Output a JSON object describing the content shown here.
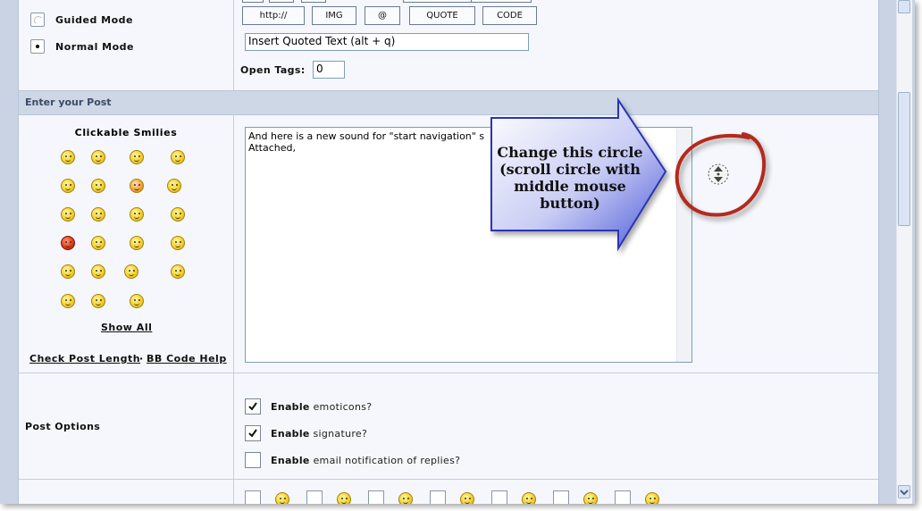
{
  "editor_mode": {
    "guided_label": "Guided Mode",
    "normal_label": "Normal Mode"
  },
  "toolbar": {
    "http_label": "http://",
    "img_label": "IMG",
    "mention_label": "@",
    "quote_label": "QUOTE",
    "code_label": "CODE",
    "quoted_text_value": "Insert Quoted Text (alt + q)",
    "open_tags_label": "Open Tags:",
    "open_tags_value": "0"
  },
  "section": {
    "enter_post_title": "Enter your Post"
  },
  "smilies": {
    "title": "Clickable Smilies",
    "show_all": "Show All",
    "check_length": "Check Post Length",
    "separator": "·",
    "bbcode_help": "BB Code Help"
  },
  "post": {
    "body_line1": "And here is a new sound for \"start navigation\" s",
    "body_line2": "Attached,"
  },
  "post_options": {
    "title": "Post Options",
    "enable_word": "Enable",
    "emoticons_rest": "emoticons?",
    "signature_rest": "signature?",
    "notify_rest": "email notification of replies?",
    "emoticons_checked": true,
    "signature_checked": true,
    "notify_checked": false
  },
  "annotation": {
    "text": "Change this circle (scroll circle with middle mouse button)"
  },
  "colors": {
    "callout_fill": "#5a66e0",
    "circle_stroke": "#c0392b",
    "category_bg": "#cdd7e6"
  }
}
